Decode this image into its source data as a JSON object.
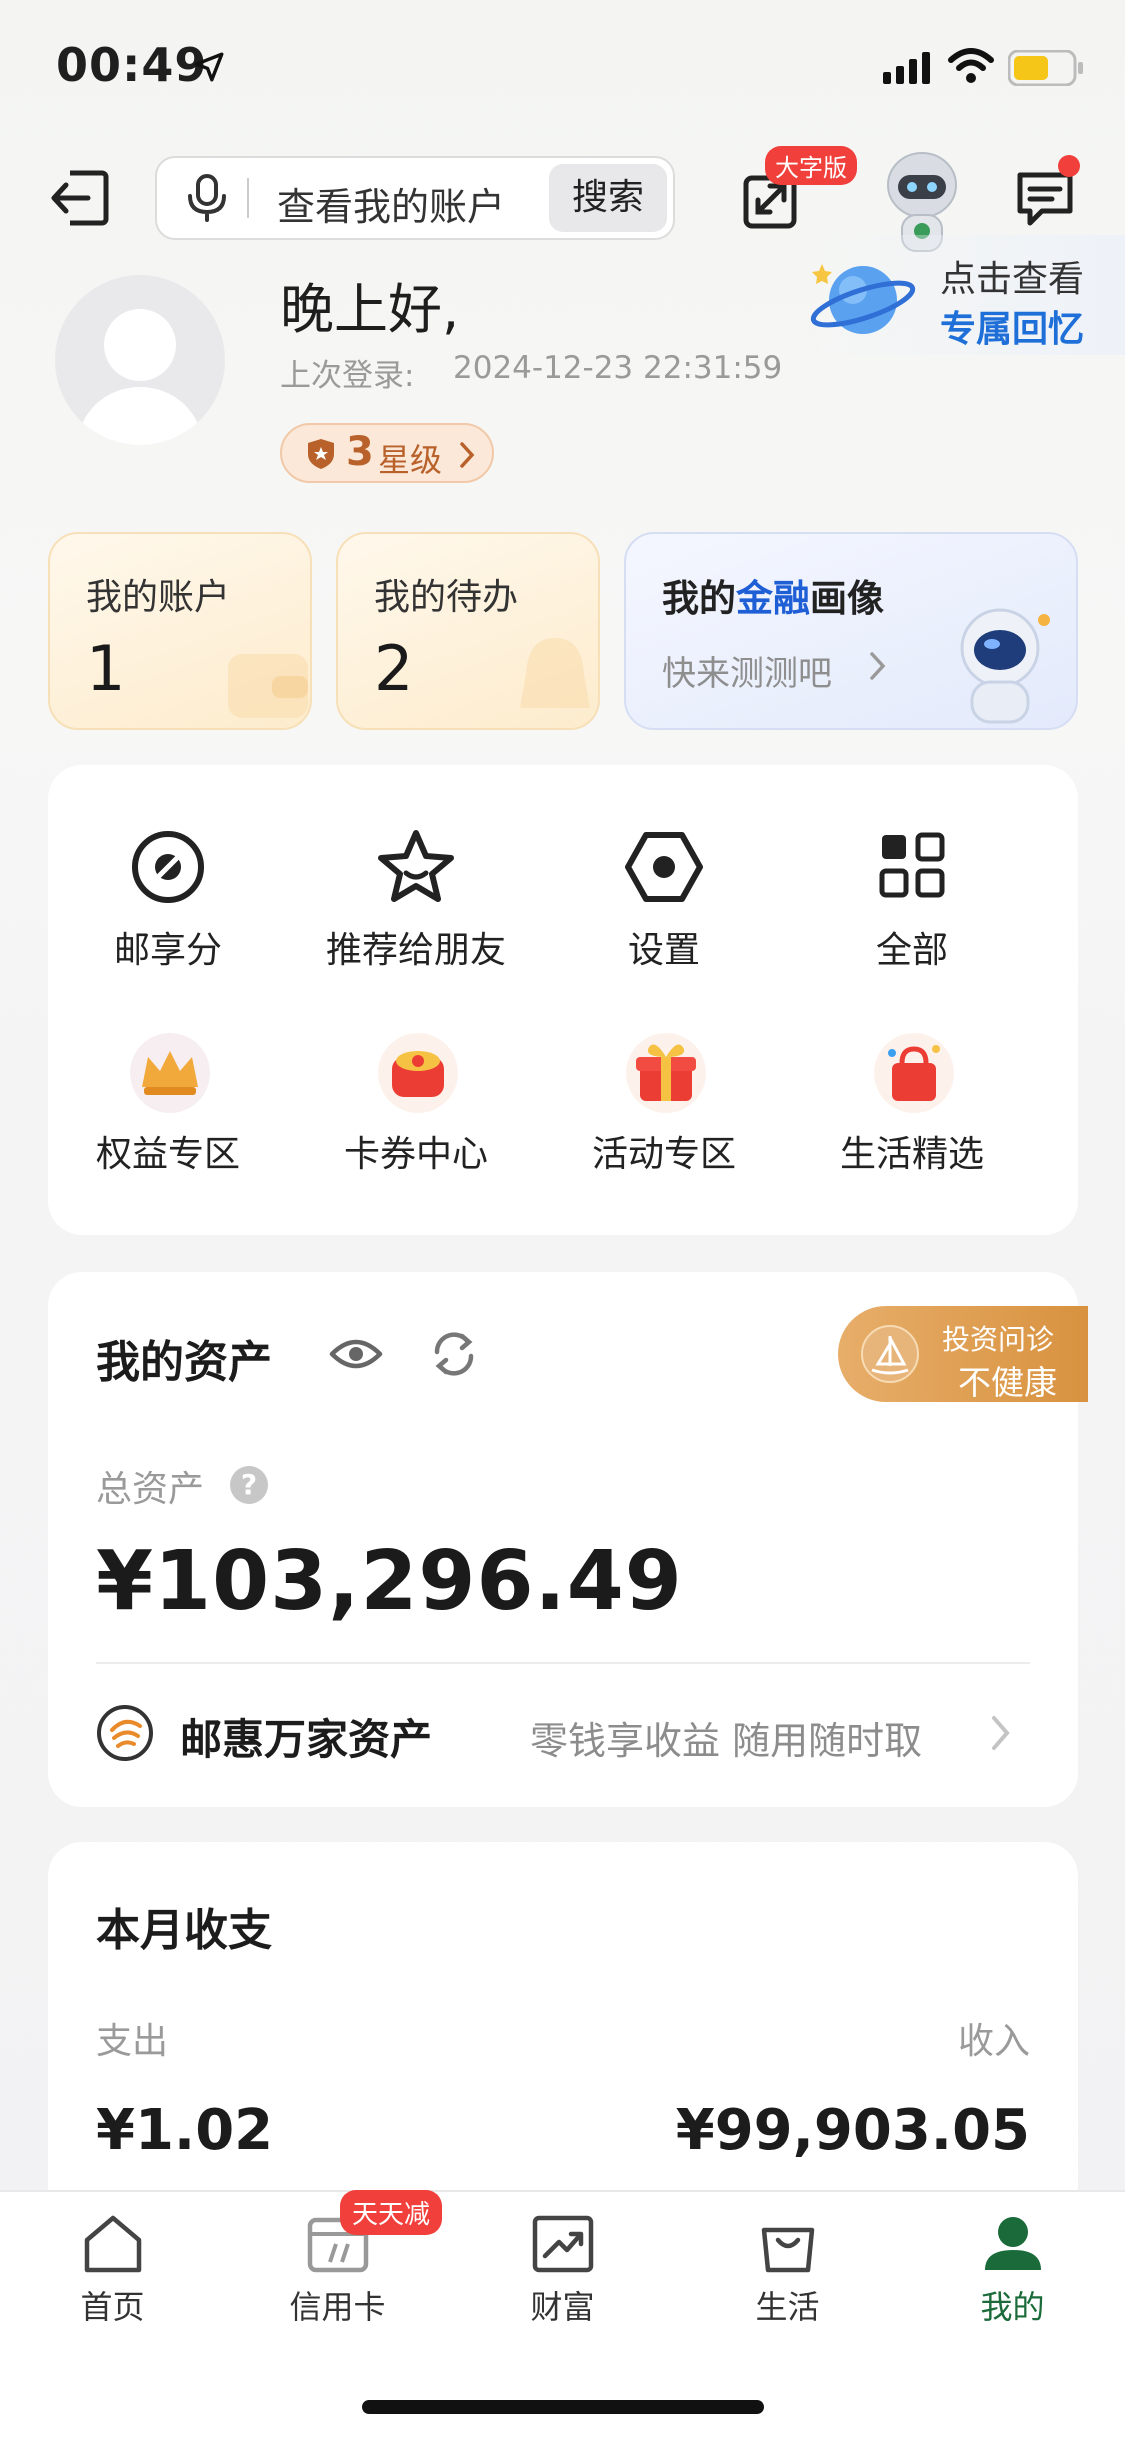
{
  "status_bar": {
    "time": "00:49"
  },
  "header": {
    "search_placeholder": "查看我的账户",
    "search_button": "搜索",
    "large_font_badge": "大字版"
  },
  "memory": {
    "line1": "点击查看",
    "line2": "专属回忆"
  },
  "profile": {
    "greeting": "晚上好,",
    "last_login_label": "上次登录:",
    "last_login_time": "2024-12-23 22:31:59",
    "star_level": "3",
    "star_label": "星级"
  },
  "quick_cards": {
    "accounts": {
      "title": "我的账户",
      "value": "1"
    },
    "todo": {
      "title": "我的待办",
      "value": "2"
    },
    "portrait": {
      "title_pre": "我的",
      "title_highlight": "金融",
      "title_post": "画像",
      "subtitle": "快来测测吧"
    }
  },
  "grid": {
    "row1": [
      "邮享分",
      "推荐给朋友",
      "设置",
      "全部"
    ],
    "row2": [
      "权益专区",
      "卡券中心",
      "活动专区",
      "生活精选"
    ]
  },
  "assets": {
    "title": "我的资产",
    "diagnosis_label": "投资问诊",
    "diagnosis_status": "不健康",
    "total_label": "总资产",
    "total_value": "¥103,296.49",
    "product_name": "邮惠万家资产",
    "product_desc": "零钱享收益 随用随时取"
  },
  "monthly": {
    "title": "本月收支",
    "expense_label": "支出",
    "income_label": "收入",
    "expense_value": "¥1.02",
    "income_value": "¥99,903.05"
  },
  "tabbar": {
    "items": [
      "首页",
      "信用卡",
      "财富",
      "生活",
      "我的"
    ],
    "credit_badge": "天天减",
    "active_color": "#1b6b3a"
  }
}
